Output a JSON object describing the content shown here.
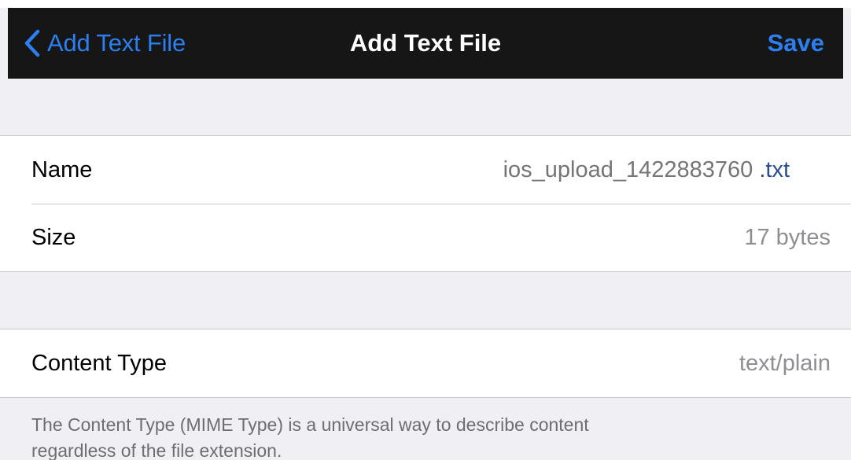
{
  "navbar": {
    "back_label": "Add Text File",
    "title": "Add Text File",
    "save_label": "Save"
  },
  "file": {
    "name_label": "Name",
    "name_value": "ios_upload_1422883760",
    "name_extension": ".txt",
    "size_label": "Size",
    "size_value": "17 bytes"
  },
  "content_type": {
    "label": "Content Type",
    "value": "text/plain",
    "description": "The Content Type (MIME Type) is a universal way to describe content regardless of the file extension."
  },
  "colors": {
    "accent": "#2b7ff0",
    "navbar_bg": "#161616",
    "background": "#efeff4"
  },
  "icons": {
    "back": "chevron-left-icon"
  }
}
